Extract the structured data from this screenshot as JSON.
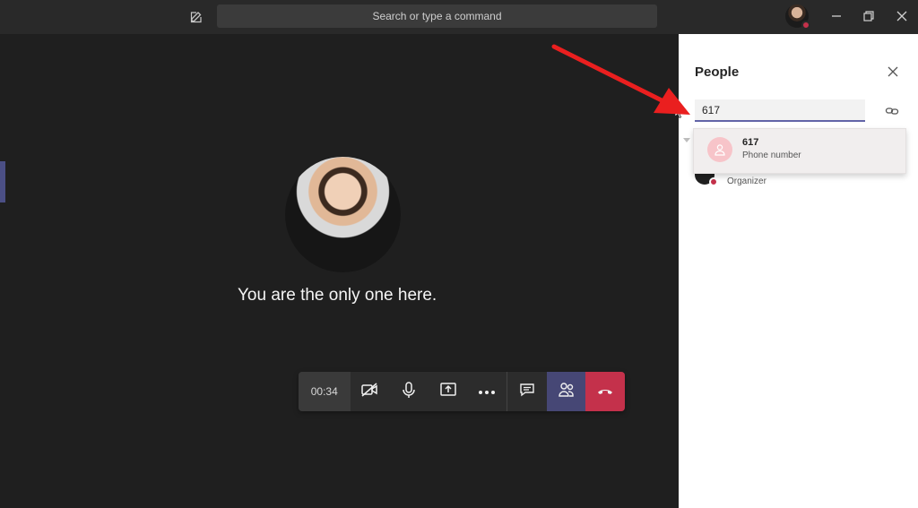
{
  "app": {
    "brand_color": "#6264a7",
    "alert_color": "#c4314b"
  },
  "titlebar": {
    "compose_icon": "compose-icon",
    "search_placeholder": "Search or type a command",
    "minimize_icon": "minimize-icon",
    "restore_icon": "restore-icon",
    "close_icon": "close-icon"
  },
  "stage": {
    "message": "You are the only one here."
  },
  "call_controls": {
    "timer": "00:34",
    "buttons": [
      {
        "name": "camera-off-button",
        "icon": "camera-off-icon"
      },
      {
        "name": "microphone-button",
        "icon": "microphone-icon"
      },
      {
        "name": "share-screen-button",
        "icon": "share-screen-icon"
      },
      {
        "name": "more-actions-button",
        "icon": "more-icon"
      },
      {
        "name": "chat-button",
        "icon": "chat-icon"
      },
      {
        "name": "show-participants-button",
        "icon": "people-icon"
      },
      {
        "name": "hang-up-button",
        "icon": "phone-hangup-icon"
      }
    ]
  },
  "people_panel": {
    "title": "People",
    "search_value": "617",
    "suggestion": {
      "name": "617",
      "type": "Phone number"
    },
    "participant": {
      "role": "Organizer"
    }
  }
}
